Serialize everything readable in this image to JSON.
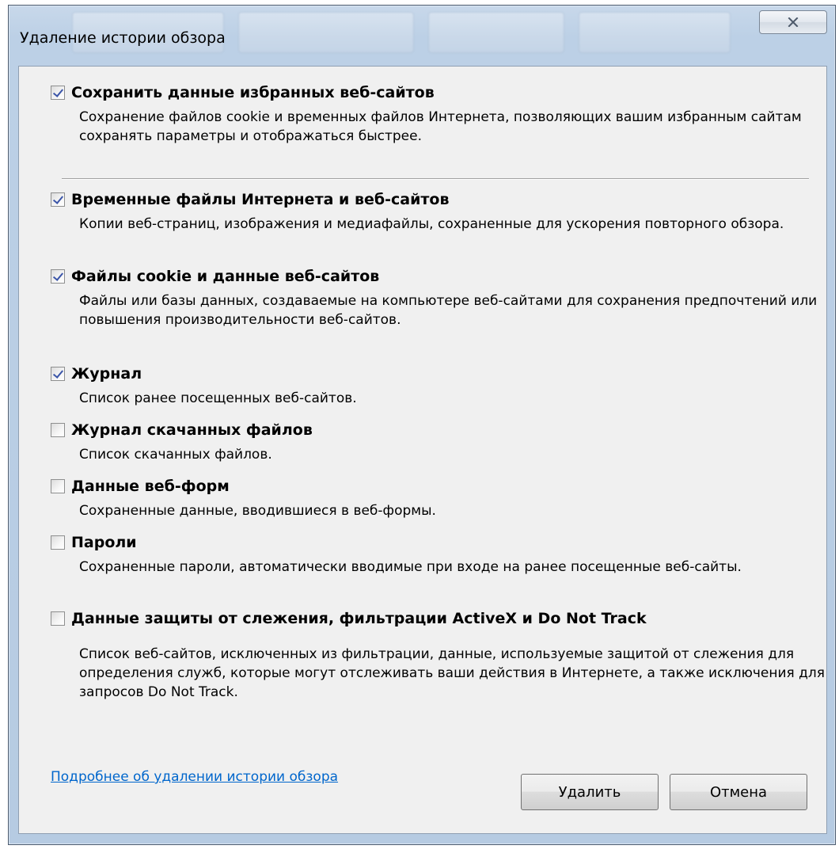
{
  "window": {
    "title": "Удаление истории обзора"
  },
  "options": [
    {
      "title": "Сохранить данные избранных веб-сайтов",
      "description": "Сохранение файлов cookie и временных файлов Интернета, позволяющих вашим избранным сайтам сохранять параметры и отображаться быстрее.",
      "checked": true
    },
    {
      "title": "Временные файлы Интернета и веб-сайтов",
      "description": "Копии веб-страниц, изображения и медиафайлы, сохраненные для ускорения повторного обзора.",
      "checked": true
    },
    {
      "title": "Файлы cookie и данные веб-сайтов",
      "description": "Файлы или базы данных, создаваемые на компьютере веб-сайтами для сохранения предпочтений или повышения производительности веб-сайтов.",
      "checked": true
    },
    {
      "title": "Журнал",
      "description": "Список ранее посещенных веб-сайтов.",
      "checked": true
    },
    {
      "title": "Журнал скачанных файлов",
      "description": "Список скачанных файлов.",
      "checked": false
    },
    {
      "title": "Данные веб-форм",
      "description": "Сохраненные данные, вводившиеся в веб-формы.",
      "checked": false
    },
    {
      "title": "Пароли",
      "description": "Сохраненные пароли, автоматически вводимые при входе на ранее посещенные веб-сайты.",
      "checked": false
    },
    {
      "title": "Данные защиты от слежения, фильтрации ActiveX и Do Not Track",
      "description": "Список веб-сайтов, исключенных из фильтрации, данные, используемые защитой от слежения для определения служб, которые могут отслеживать ваши действия в Интернете, а также исключения для запросов Do Not Track.",
      "checked": false
    }
  ],
  "footer": {
    "learn_more_link": "Подробнее об удалении истории обзора",
    "delete_label": "Удалить",
    "cancel_label": "Отмена"
  },
  "icons": {
    "close": "close-icon",
    "checkmark": "checkmark-icon"
  },
  "colors": {
    "link": "#0066cc",
    "checkmark": "#3b55a8",
    "client_bg": "#f0f0f0"
  }
}
